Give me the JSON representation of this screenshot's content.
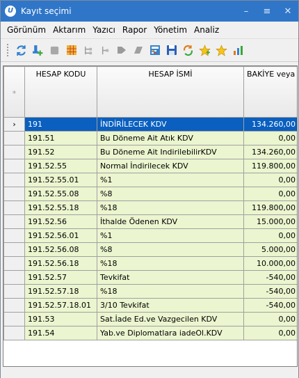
{
  "window": {
    "title": "Kayıt seçimi",
    "icon_letter": "U"
  },
  "title_controls": [
    "–",
    "≡",
    "✕"
  ],
  "menu": [
    "Görünüm",
    "Aktarım",
    "Yazıcı",
    "Rapor",
    "Yönetim",
    "Analiz"
  ],
  "toolbar": [
    "refresh-icon",
    "add-icon",
    "record-icon",
    "grid-icon",
    "tree-icon",
    "tree-collapse-icon",
    "back-icon",
    "forward-icon",
    "calculator-icon",
    "save-icon",
    "sync-icon",
    "star-add-icon",
    "star-icon",
    "chart-icon"
  ],
  "columns": {
    "indicator": "*",
    "code": "HESAP KODU",
    "name": "HESAP İSMİ",
    "balance": "BAKİYE veya HAREKET SAYISI"
  },
  "rows": [
    {
      "indicator": "›",
      "code": "191",
      "name": "İNDİRİLECEK KDV",
      "balance": "134.260,00"
    },
    {
      "code": "191.51",
      "name": "Bu Döneme Ait Atık KDV",
      "balance": "0,00"
    },
    {
      "code": "191.52",
      "name": "Bu Döneme Ait IndirilebilirKDV",
      "balance": "134.260,00"
    },
    {
      "code": "191.52.55",
      "name": "Normal İndirilecek KDV",
      "balance": "119.800,00"
    },
    {
      "code": "191.52.55.01",
      "name": "%1",
      "balance": "0,00"
    },
    {
      "code": "191.52.55.08",
      "name": "%8",
      "balance": "0,00"
    },
    {
      "code": "191.52.55.18",
      "name": "%18",
      "balance": "119.800,00"
    },
    {
      "code": "191.52.56",
      "name": "İthalde Ödenen KDV",
      "balance": "15.000,00"
    },
    {
      "code": "191.52.56.01",
      "name": "%1",
      "balance": "0,00"
    },
    {
      "code": "191.52.56.08",
      "name": "%8",
      "balance": "5.000,00"
    },
    {
      "code": "191.52.56.18",
      "name": "%18",
      "balance": "10.000,00"
    },
    {
      "code": "191.52.57",
      "name": "Tevkifat",
      "balance": "-540,00"
    },
    {
      "code": "191.52.57.18",
      "name": "%18",
      "balance": "-540,00"
    },
    {
      "code": "191.52.57.18.01",
      "name": "3/10 Tevkifat",
      "balance": "-540,00"
    },
    {
      "code": "191.53",
      "name": "Sat.İade Ed.ve Vazgecilen KDV",
      "balance": "0,00"
    },
    {
      "code": "191.54",
      "name": "Yab.ve Diplomatlara iadeOl.KDV",
      "balance": "0,00"
    }
  ],
  "colors": {
    "title_bar": "#2f76c8",
    "row_bg": "#ebf5cf",
    "selected_bg": "#0a5fbf"
  }
}
